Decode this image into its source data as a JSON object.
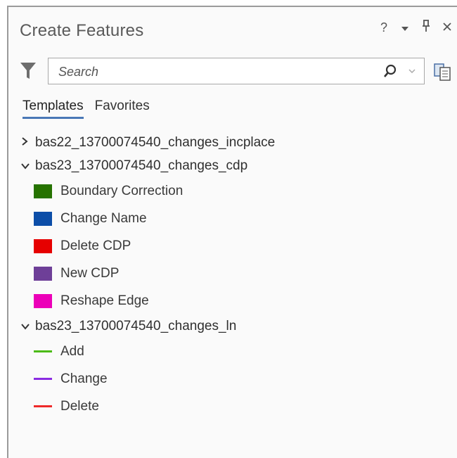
{
  "panel": {
    "title": "Create Features",
    "help_label": "?",
    "menu_label": "▾",
    "pin_label": "⊓",
    "close_label": "✕"
  },
  "search": {
    "placeholder": "Search"
  },
  "tabs": [
    {
      "label": "Templates",
      "active": true
    },
    {
      "label": "Favorites",
      "active": false
    }
  ],
  "layers": [
    {
      "name": "bas22_13700074540_changes_incplace",
      "expanded": false,
      "templates": []
    },
    {
      "name": "bas23_13700074540_changes_cdp",
      "expanded": true,
      "templates": [
        {
          "label": "Boundary Correction",
          "symbol": "polygon",
          "color": "#267300"
        },
        {
          "label": "Change Name",
          "symbol": "polygon",
          "color": "#0c4ea8"
        },
        {
          "label": "Delete CDP",
          "symbol": "polygon",
          "color": "#e60000"
        },
        {
          "label": "New CDP",
          "symbol": "polygon",
          "color": "#6e3f98"
        },
        {
          "label": "Reshape Edge",
          "symbol": "polygon",
          "color": "#ec00b8"
        }
      ]
    },
    {
      "name": "bas23_13700074540_changes_ln",
      "expanded": true,
      "templates": [
        {
          "label": "Add",
          "symbol": "line",
          "color": "#4cbb17"
        },
        {
          "label": "Change",
          "symbol": "line",
          "color": "#8a2be2"
        },
        {
          "label": "Delete",
          "symbol": "line",
          "color": "#ee2a2a"
        }
      ]
    }
  ]
}
